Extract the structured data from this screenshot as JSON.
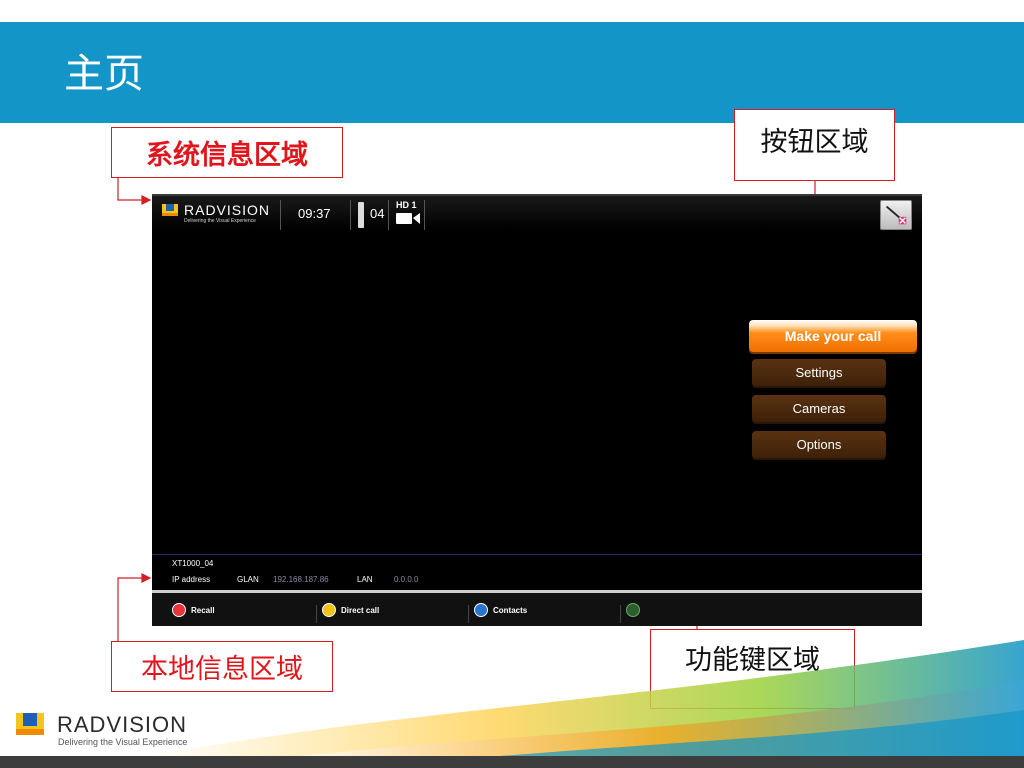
{
  "slide": {
    "title": "主页"
  },
  "callouts": {
    "system_info": "系统信息区域",
    "buttons_area": "按钮区域",
    "local_info": "本地信息区域",
    "function_keys": "功能键区域"
  },
  "device": {
    "logo_word": "RADVISION",
    "logo_tagline": "Delivering the Visual Experience",
    "clock": "09:37",
    "channel": "04",
    "hd_label": "HD 1",
    "menu": {
      "make_call": "Make your call",
      "settings": "Settings",
      "cameras": "Cameras",
      "options": "Options"
    },
    "info": {
      "name": "XT1000_04",
      "ip_label": "IP address",
      "glan_label": "GLAN",
      "glan_value": "192.168.187.86",
      "lan_label": "LAN",
      "lan_value": "0.0.0.0"
    },
    "function_keys": {
      "recall": "Recall",
      "direct_call": "Direct call",
      "contacts": "Contacts"
    }
  },
  "footer": {
    "logo_word": "RADVISION",
    "logo_tagline": "Delivering the Visual Experience"
  },
  "colors": {
    "header_blue": "#1495c7",
    "callout_red": "#d11f24",
    "make_call_orange": "#f06f00",
    "menu_brown": "#4a2810",
    "recall_red": "#e8323c",
    "direct_yellow": "#f2c21b",
    "contacts_blue": "#2c72cf"
  },
  "icons": [
    "exit-icon",
    "camera-icon",
    "signal-icon",
    "recall-icon",
    "direct-call-icon",
    "contacts-icon",
    "more-icon"
  ]
}
